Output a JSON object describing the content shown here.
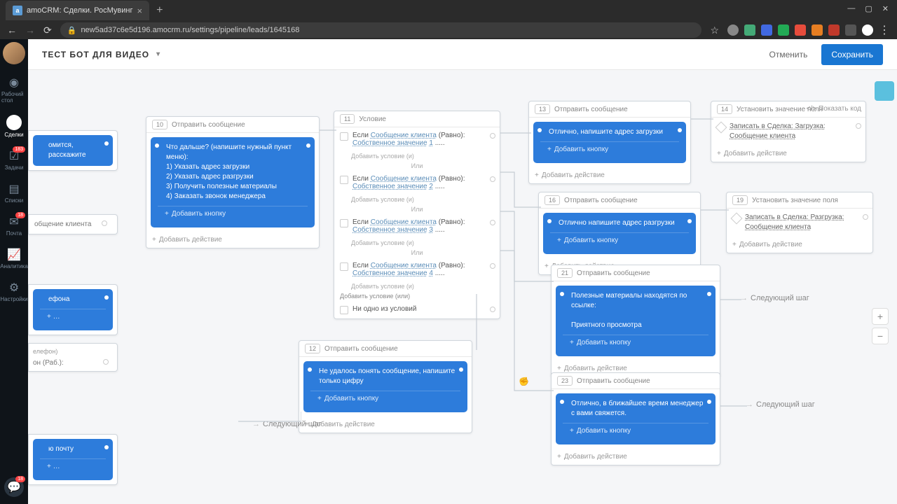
{
  "browser": {
    "tab_title": "amoCRM: Сделки. РосМувинг",
    "url": "new5ad37c6e5d196.amocrm.ru/settings/pipeline/leads/1645168"
  },
  "sidebar": {
    "items": [
      {
        "label": "Рабочий стол"
      },
      {
        "label": "Сделки"
      },
      {
        "label": "Задачи",
        "badge": "183"
      },
      {
        "label": "Списки"
      },
      {
        "label": "Почта",
        "badge": "18"
      },
      {
        "label": "Аналитика"
      },
      {
        "label": "Настройки"
      }
    ],
    "chat_badge": "18"
  },
  "topbar": {
    "title": "ТЕСТ БОТ ДЛЯ ВИДЕО",
    "cancel": "Отменить",
    "save": "Сохранить"
  },
  "labels": {
    "send_message": "Отправить сообщение",
    "condition": "Условие",
    "set_field": "Установить значение поля",
    "add_button": "Добавить кнопку",
    "add_action": "Добавить действие",
    "add_condition_and": "Добавить условие (и)",
    "add_condition_or": "Добавить условие (или)",
    "none_condition": "Ни одно из условий",
    "or": "Или",
    "show_code": "Показать код",
    "next_step": "Следующий шаг"
  },
  "nodes": {
    "n10": {
      "num": "10",
      "text": "Что дальше? (напишите нужный пункт меню):\n1) Указать адрес загрузки\n2) Указать адрес разгрузки\n3) Получить полезные материалы\n4) Заказать звонок менеджера"
    },
    "n11": {
      "num": "11",
      "c1": {
        "pre": "Если",
        "a": "Сообщение клиента",
        "mid": "(Равно):",
        "b": "Собственное значение",
        "val": "1"
      },
      "c2": {
        "pre": "Если",
        "a": "Сообщение клиента",
        "mid": "(Равно):",
        "b": "Собственное значение",
        "val": "2"
      },
      "c3": {
        "pre": "Если",
        "a": "Сообщение клиента",
        "mid": "(Равно):",
        "b": "Собственное значение",
        "val": "3"
      },
      "c4": {
        "pre": "Если",
        "a": "Сообщение клиента",
        "mid": "(Равно):",
        "b": "Собственное значение",
        "val": "4"
      }
    },
    "n12": {
      "num": "12",
      "text": "Не удалось понять сообщение, напишите только цифру"
    },
    "n13": {
      "num": "13",
      "text": "Отлично, напишите адрес загрузки"
    },
    "n14": {
      "num": "14",
      "text": "Записать в Сделка: Загрузка: Сообщение клиента"
    },
    "n16": {
      "num": "16",
      "text": "Отлично напишите адрес разгрузки"
    },
    "n19": {
      "num": "19",
      "text": "Записать в Сделка: Разгрузка: Сообщение клиента"
    },
    "n21": {
      "num": "21",
      "text1": "Полезные материалы находятся по ссылке:",
      "text2": "Приятного просмотра"
    },
    "n23": {
      "num": "23",
      "text": "Отлично, в ближайшее время менеджер с вами свяжется."
    }
  },
  "partials": {
    "p1": "омится, расскажите",
    "p2": "общение клиента",
    "p3": "ефона",
    "p4_label": "елефон)",
    "p4_field": "он (Раб.):",
    "p5": "ю почту"
  }
}
